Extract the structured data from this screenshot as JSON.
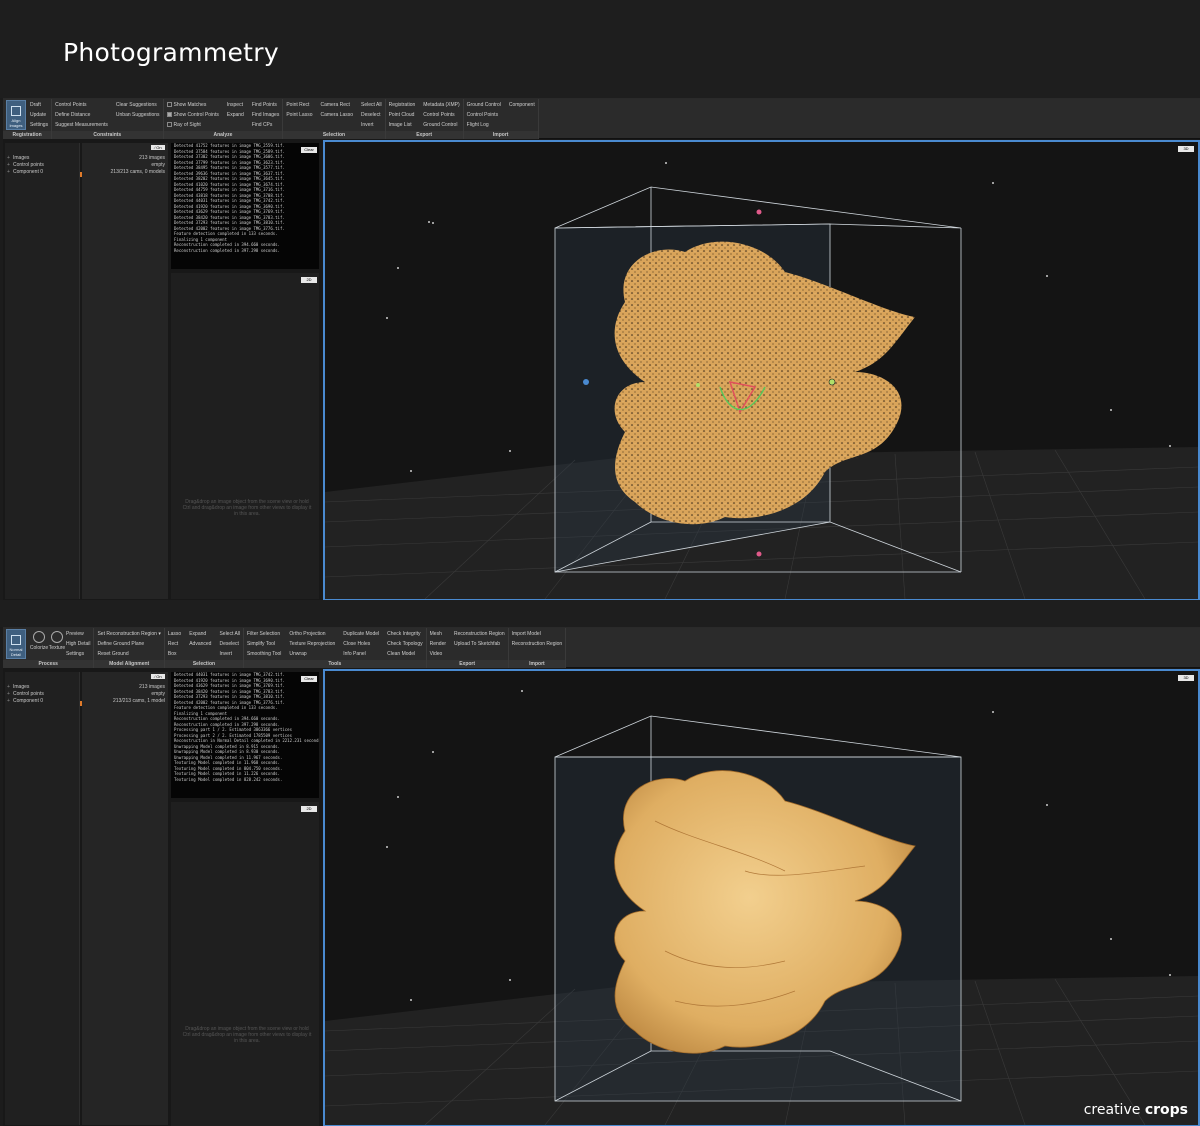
{
  "header": {
    "title": "Photogrammetry"
  },
  "watermark": {
    "text": "creative",
    "bold": "crops"
  },
  "shot1": {
    "ribbon": {
      "big_button": "Align Images",
      "groups": [
        {
          "label": "Registration",
          "items": [
            "Draft",
            "Update",
            "Settings"
          ]
        },
        {
          "label": "Constraints",
          "items": [
            "Control Points",
            "Define Distance",
            "Suggest Measurements",
            "Clear Suggestions",
            "Unban Suggestions",
            ""
          ]
        },
        {
          "label": "Analyze",
          "items": [
            "Show Matches",
            "Show Control Points",
            "Ray of Sight",
            "Inspect",
            "Expand",
            "",
            "Find Points",
            "Find Images",
            "Find CPs"
          ]
        },
        {
          "label": "Selection",
          "items": [
            "Point Rect",
            "Point Lasso",
            "",
            "Camera Rect",
            "Camera Lasso",
            "",
            "Select All",
            "Deselect",
            "Invert"
          ]
        },
        {
          "label": "Export",
          "items": [
            "Registration",
            "Point Cloud",
            "Image List",
            "Metadata (XMP)",
            "Control Points",
            "Ground Control"
          ]
        },
        {
          "label": "Import",
          "items": [
            "Ground Control",
            "Control Points",
            "Flight Log",
            "Component",
            "",
            ""
          ]
        }
      ]
    },
    "tree": [
      "Images",
      "Control points",
      "Component 0"
    ],
    "mid": {
      "button": "⁄ On",
      "rows": [
        "213 images",
        "empty",
        "213/213 cams, 0 models"
      ]
    },
    "log_button": "Clear",
    "twod_button": "2D",
    "viewport_button": "3D",
    "hint": "Drag&drop an image object from the scene view or hold Ctrl and drag&drop an image from other views to display it in this area.",
    "log": [
      "Detected 41752 features in image TMG_2559.tif.",
      "Detected 37584 features in image TMG_2589.tif.",
      "Detected 37302 features in image TMG_3606.tif.",
      "Detected 37799 features in image TMG_3623.tif.",
      "Detected 38495 features in image TMG_3577.tif.",
      "Detected 39636 features in image TMG_3637.tif.",
      "Detected 38202 features in image TMG_3645.tif.",
      "Detected 41020 features in image TMG_3674.tif.",
      "Detected 44759 features in image TMG_3716.tif.",
      "Detected 43818 features in image TMG_3708.tif.",
      "Detected 44031 features in image TMG_3742.tif.",
      "Detected 41920 features in image TMG_3690.tif.",
      "Detected 43629 features in image TMG_3769.tif.",
      "Detected 38420 features in image TMG_3783.tif.",
      "Detected 37293 features in image TMG_3810.tif.",
      "Detected 42002 features in image TMG_3776.tif.",
      "Feature detection completed in 133 seconds.",
      "Finalizing 1 component",
      "Reconstruction completed in 394.660 seconds.",
      "Reconstruction completed in 397.298 seconds."
    ]
  },
  "shot2": {
    "ribbon": {
      "big_button": "Normal Detail",
      "groups": [
        {
          "label": "Process",
          "items": [
            "Preview",
            "High Detail",
            "Settings"
          ],
          "icons": [
            "Colorize",
            "Texture"
          ]
        },
        {
          "label": "Model Alignment",
          "items": [
            "Set Reconstruction Region ▾",
            "Define Ground Plane",
            "Reset Ground"
          ]
        },
        {
          "label": "Selection",
          "items": [
            "Lasso",
            "Rect",
            "Box",
            "Expand",
            "Advanced",
            "",
            "Select All",
            "Deselect",
            "Invert"
          ]
        },
        {
          "label": "Tools",
          "items": [
            "Filter Selection",
            "Simplify Tool",
            "Smoothing Tool",
            "Ortho Projection",
            "Texture Reprojection",
            "Unwrap",
            "Duplicate Model",
            "Close Holes",
            "Info Panel",
            "Check Integrity",
            "Check Topology",
            "Clean Model"
          ]
        },
        {
          "label": "Export",
          "items": [
            "Mesh",
            "Render",
            "Video",
            "Reconstruction Region",
            "Upload To Sketchfab",
            ""
          ]
        },
        {
          "label": "Import",
          "items": [
            "Import Model",
            "Reconstruction Region",
            ""
          ]
        }
      ]
    },
    "tree": [
      "Images",
      "Control points",
      "Component 0"
    ],
    "mid": {
      "button": "⁄ On",
      "rows": [
        "213 images",
        "empty",
        "213/213 cams, 1 model"
      ]
    },
    "log_button": "Clear",
    "twod_button": "2D",
    "viewport_button": "3D",
    "hint": "Drag&drop an image object from the scene view or hold Ctrl and drag&drop an image from other views to display it in this area.",
    "log": [
      "Detected 44031 features in image TMG_3742.tif.",
      "Detected 41920 features in image TMG_3690.tif.",
      "Detected 43629 features in image TMG_3769.tif.",
      "Detected 38420 features in image TMG_3783.tif.",
      "Detected 37293 features in image TMG_3810.tif.",
      "Detected 42002 features in image TMG_3776.tif.",
      "Feature detection completed in 133 seconds.",
      "Finalizing 1 component",
      "Reconstruction completed in 394.660 seconds.",
      "Reconstruction completed in 397.298 seconds.",
      "Processing part 1 / 2. Estimated 3863366 vertices",
      "Processing part 2 / 2. Estimated 1785509 vertices",
      "Reconstruction in Normal Detail completed in 2212.231 seconds.",
      "Unwrapping Model completed in 8.915 seconds.",
      "Unwrapping Model completed in 8.930 seconds.",
      "Unwrapping Model completed in 11.967 seconds.",
      "Texturing Model completed in 11.968 seconds.",
      "Texturing Model completed in 804.750 seconds.",
      "Texturing Model completed in 11.226 seconds.",
      "Texturing Model completed in 828.242 seconds."
    ]
  },
  "colors": {
    "accent_blue": "#4a8ad0",
    "walnut": "#d9a45a",
    "accent_orange": "#e07b2a"
  }
}
